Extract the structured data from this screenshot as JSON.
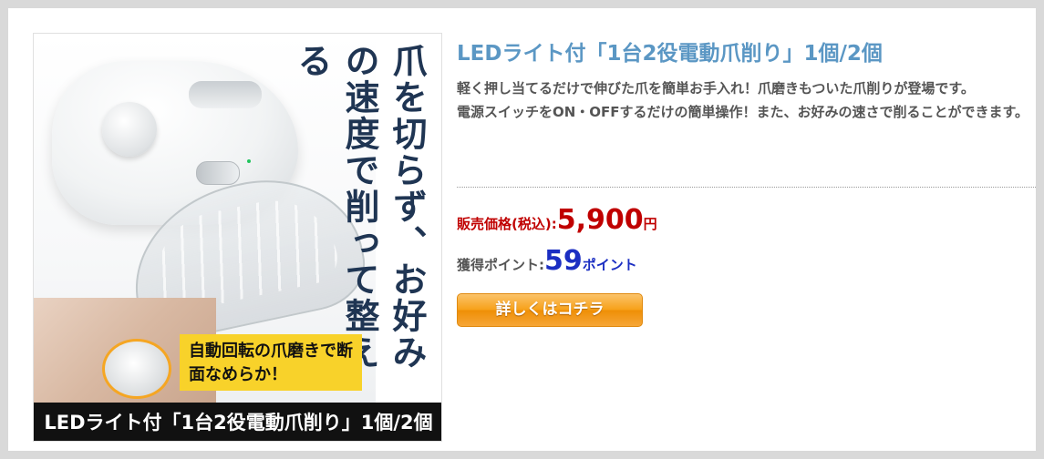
{
  "product": {
    "title": "LEDライト付「1台2役電動爪削り」1個/2個",
    "description": [
      "軽く押し当てるだけで伸びた爪を簡単お手入れ！爪磨きもついた爪削りが登場です。",
      "電源スイッチをON・OFFするだけの簡単操作！また、お好みの速さで削ることができます。"
    ],
    "price": {
      "label": "販売価格(税込):",
      "value": "5,900",
      "unit": "円"
    },
    "points": {
      "label": "獲得ポイント:",
      "value": "59",
      "unit": "ポイント"
    },
    "details_button_label": "詳しくはコチラ"
  },
  "image": {
    "vertical_copy": "爪を切らず、お好みの速度で削って整える",
    "yellow_label": "自動回転の爪磨きで断面なめらか！",
    "caption": "LEDライト付「1台2役電動爪削り」1個/2個"
  },
  "colors": {
    "title": "#5b97c4",
    "price": "#c00000",
    "points": "#1b2ec2",
    "button": "#f7a21b",
    "frame": "#d9d9d9"
  }
}
